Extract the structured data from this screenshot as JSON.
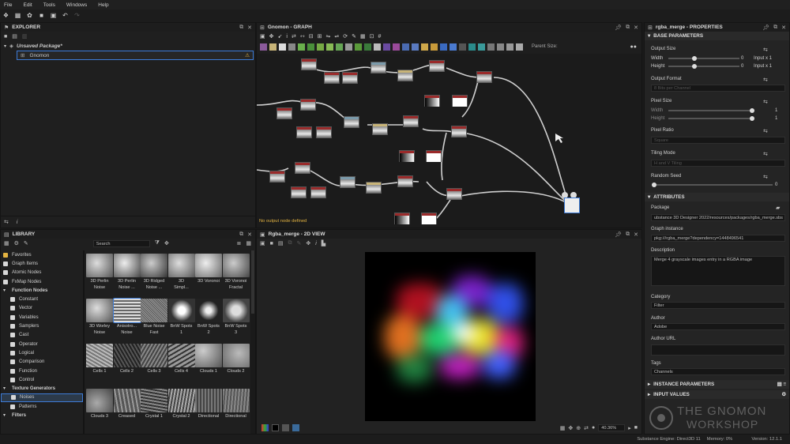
{
  "menu": [
    "File",
    "Edit",
    "Tools",
    "Windows",
    "Help"
  ],
  "explorer": {
    "title": "EXPLORER",
    "package": "Unsaved Package*",
    "graph": "Gnomon"
  },
  "graph": {
    "title": "Gnomon - GRAPH",
    "parent_size_label": "Parent Size:",
    "status": "No output node defined"
  },
  "library": {
    "title": "LIBRARY",
    "search_placeholder": "Search",
    "categories": [
      {
        "label": "Favorites",
        "level": 0
      },
      {
        "label": "Graph Items",
        "level": 0
      },
      {
        "label": "Atomic Nodes",
        "level": 0
      },
      {
        "label": "FxMap Nodes",
        "level": 0
      },
      {
        "label": "Function Nodes",
        "level": 0,
        "bold": true
      },
      {
        "label": "Constant",
        "level": 1
      },
      {
        "label": "Vector",
        "level": 1
      },
      {
        "label": "Variables",
        "level": 1
      },
      {
        "label": "Samplers",
        "level": 1
      },
      {
        "label": "Cast",
        "level": 1
      },
      {
        "label": "Operator",
        "level": 1
      },
      {
        "label": "Logical",
        "level": 1
      },
      {
        "label": "Comparison",
        "level": 1
      },
      {
        "label": "Function",
        "level": 1
      },
      {
        "label": "Control",
        "level": 1
      },
      {
        "label": "Texture Generators",
        "level": 0,
        "bold": true
      },
      {
        "label": "Noises",
        "level": 1,
        "selected": true
      },
      {
        "label": "Patterns",
        "level": 1
      },
      {
        "label": "Filters",
        "level": 0,
        "bold": true
      }
    ],
    "items": [
      "3D Perlin\nNoise",
      "3D Perlin\nNoise ...",
      "3D Ridged\nNoise ...",
      "3D\nSimpl...",
      "3D Voronoi",
      "3D Voronoi\nFractal",
      "3D Worley\nNoise",
      "Anisotro...\nNoise",
      "Blue Noise\nFast",
      "BnW Spots\n1",
      "BnW Spots\n2",
      "BnW Spots\n3",
      "Cells 1",
      "Cells 2",
      "Cells 3",
      "Cells 4",
      "Clouds 1",
      "Clouds 2",
      "Clouds 3",
      "Creased",
      "Crystal 1",
      "Crystal 2",
      "Directional",
      "Directional"
    ]
  },
  "view2d": {
    "title": "Rgba_merge - 2D VIEW",
    "zoom": "40.36%"
  },
  "properties": {
    "title": "rgba_merge - PROPERTIES",
    "base_parameters": "BASE PARAMETERS",
    "output_size": "Output Size",
    "width": "Width",
    "height": "Height",
    "zero": "0",
    "input_x1": "Input x 1",
    "output_format": "Output Format",
    "output_format_value": "8 Bits per Channel",
    "pixel_size": "Pixel Size",
    "one": "1",
    "pixel_ratio": "Pixel Ratio",
    "pixel_ratio_value": "Square",
    "tiling_mode": "Tiling Mode",
    "tiling_mode_value": "H and V Tiling",
    "random_seed": "Random Seed",
    "attributes": "ATTRIBUTES",
    "package": "Package",
    "package_value": "ubstance 3D Designer 2022/resources/packages/rgba_merge.sbs",
    "graph_instance": "Graph instance",
    "graph_instance_value": "pkg:///rgba_merge?dependency=1448496541",
    "description": "Description",
    "description_value": "Merge 4 grayscale images entry in a RGBA image",
    "category": "Category",
    "category_value": "Filter",
    "author": "Author",
    "author_value": "Adobe",
    "author_url": "Author URL",
    "tags": "Tags",
    "tags_value": "Channels",
    "instance_parameters": "INSTANCE PARAMETERS",
    "input_values": "INPUT VALUES"
  },
  "watermark": {
    "line1": "THE GNOMON",
    "line2": "WORKSHOP"
  },
  "statusbar": {
    "engine": "Substance Engine: Direct3D 11",
    "memory": "Memory: 0%",
    "version": "Version: 12.1.1"
  },
  "colors": {
    "accent": "#3d7bd6",
    "node_header": "#9a2a2a",
    "warning": "#e3b341"
  }
}
